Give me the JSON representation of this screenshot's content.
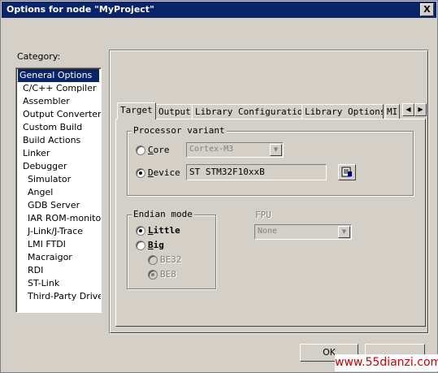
{
  "window": {
    "title": "Options for node \"MyProject\"",
    "close_label": "X"
  },
  "category": {
    "label": "Category:",
    "items": [
      "General Options",
      "C/C++ Compiler",
      "Assembler",
      "Output Converter",
      "Custom Build",
      "Build Actions",
      "Linker",
      "Debugger",
      "Simulator",
      "Angel",
      "GDB Server",
      "IAR ROM-monitor",
      "J-Link/J-Trace",
      "LMI FTDI",
      "Macraigor",
      "RDI",
      "ST-Link",
      "Third-Party Driver"
    ],
    "selected_index": 0
  },
  "tabs": [
    "Target",
    "Output",
    "Library Configuration",
    "Library Options",
    "MI"
  ],
  "processor_variant": {
    "title": "Processor variant",
    "core_label": "Core",
    "core_value": "Cortex-M3",
    "device_label": "Device",
    "device_value": "ST STM32F10xxB",
    "selected": "Device"
  },
  "endian_mode": {
    "title": "Endian mode",
    "little_label": "Little",
    "big_label": "Big",
    "be32_label": "BE32",
    "be8_label": "BE8",
    "selected": "Little"
  },
  "fpu": {
    "label": "FPU",
    "value": "None"
  },
  "buttons": {
    "ok": "OK"
  },
  "watermark": "www.55dianzi.com"
}
